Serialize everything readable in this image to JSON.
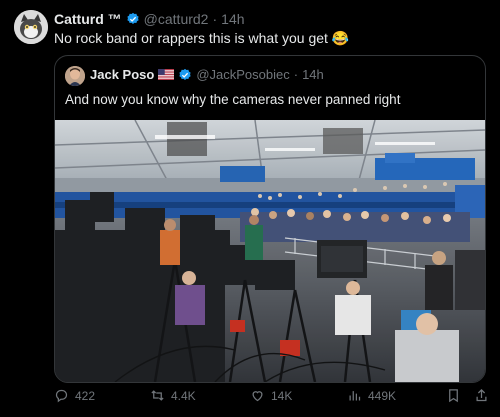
{
  "tweet": {
    "display_name": "Catturd ™",
    "handle": "@catturd2",
    "separator": "·",
    "time": "14h",
    "text": "No rock band or rappers this is what you get 😂"
  },
  "quoted": {
    "display_name": "Jack Poso",
    "handle": "@JackPosobiec",
    "separator": "·",
    "time": "14h",
    "text": "And now you know why the cameras never panned right"
  },
  "actions": {
    "replies": "422",
    "reposts": "4.4K",
    "likes": "14K",
    "views": "449K"
  },
  "colors": {
    "background": "#000000",
    "text": "#e7e9ea",
    "muted": "#71767b",
    "verified": "#1d9bf0"
  }
}
